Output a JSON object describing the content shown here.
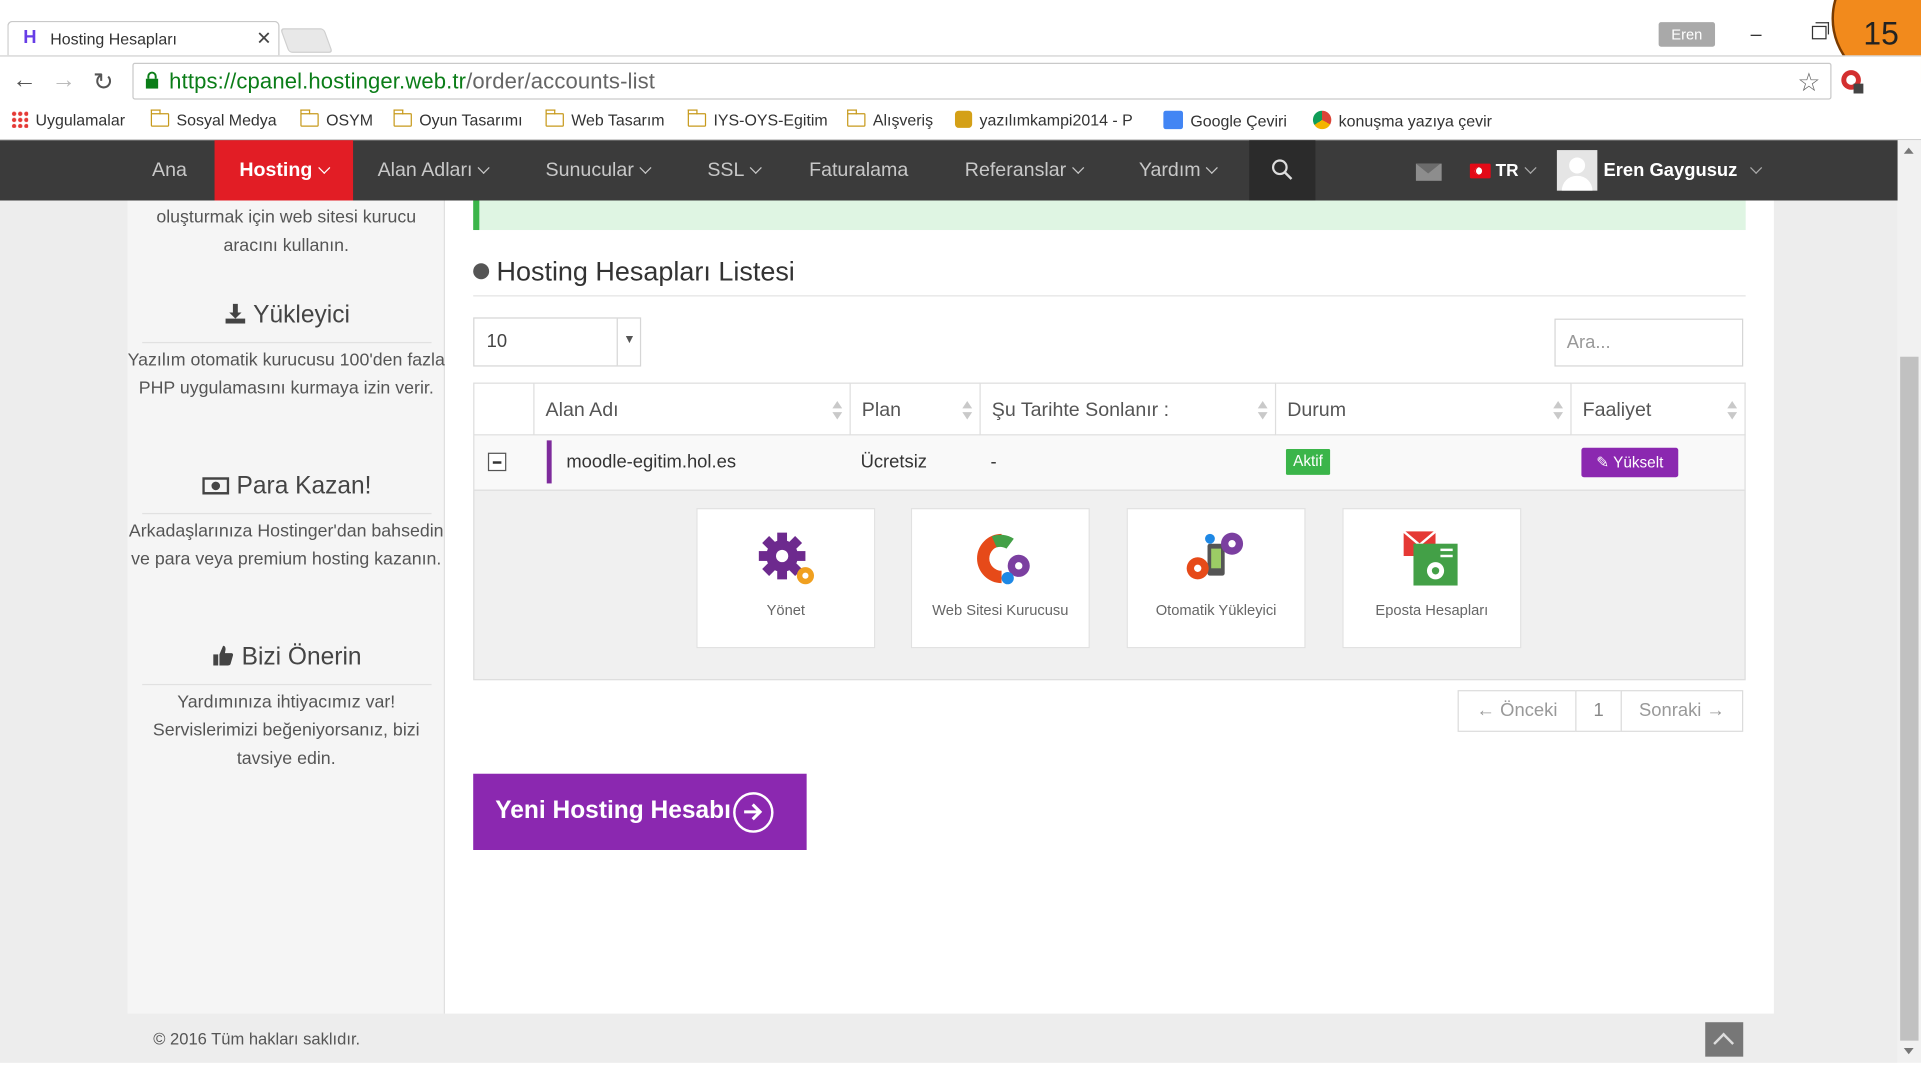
{
  "browser": {
    "tab_title": "Hosting Hesapları",
    "tab_close": "✕",
    "profile_name": "Eren",
    "url_host": "https://cpanel.hostinger.web.tr",
    "url_path": "/order/accounts-list",
    "overlay_number": "15",
    "bookmarks": [
      "Uygulamalar",
      "Sosyal Medya",
      "OSYM",
      "Oyun Tasarımı",
      "Web Tasarım",
      "IYS-OYS-Egitim",
      "Alışveriş",
      "yazılımkampi2014 - P",
      "Google Çeviri",
      "konuşma yazıya çevir"
    ]
  },
  "nav": {
    "items": [
      "Ana",
      "Hosting",
      "Alan Adları",
      "Sunucular",
      "SSL",
      "Faturalama",
      "Referanslar",
      "Yardım"
    ],
    "active": "Hosting",
    "language": "TR",
    "user": "Eren Gaygusuz"
  },
  "sidebar": {
    "intro": "oluşturmak için web sitesi kurucu aracını kullanın.",
    "sections": [
      {
        "title": "Yükleyici",
        "icon": "download-icon",
        "text": "Yazılım otomatik kurucusu 100'den fazla PHP uygulamasını kurmaya izin verir."
      },
      {
        "title": "Para Kazan!",
        "icon": "money-icon",
        "text": "Arkadaşlarınıza Hostinger'dan bahsedin ve para veya premium hosting kazanın."
      },
      {
        "title": "Bizi Önerin",
        "icon": "thumbs-up-icon",
        "text": "Yardımınıza ihtiyacımız var! Servislerimizi beğeniyorsanız, bizi tavsiye edin."
      }
    ]
  },
  "main": {
    "title": "Hosting Hesapları Listesi",
    "page_size": "10",
    "search_placeholder": "Ara...",
    "columns": [
      "Alan Adı",
      "Plan",
      "Şu Tarihte Sonlanır :",
      "Durum",
      "Faaliyet"
    ],
    "rows": [
      {
        "domain": "moodle-egitim.hol.es",
        "plan": "Ücretsiz",
        "expires": "-",
        "status": "Aktif",
        "action": "Yükselt"
      }
    ],
    "tiles": [
      "Yönet",
      "Web Sitesi Kurucusu",
      "Otomatik Yükleyici",
      "Eposta Hesapları"
    ],
    "pager": {
      "prev": "← Önceki",
      "page": "1",
      "next": "Sonraki →"
    },
    "new_button": "Yeni Hosting Hesabı"
  },
  "footer": "© 2016 Tüm hakları saklıdır.",
  "colors": {
    "brand_red": "#e21d25",
    "purple": "#8b28b0",
    "green": "#3bb54a",
    "nav_bg": "#3b3b3b"
  }
}
